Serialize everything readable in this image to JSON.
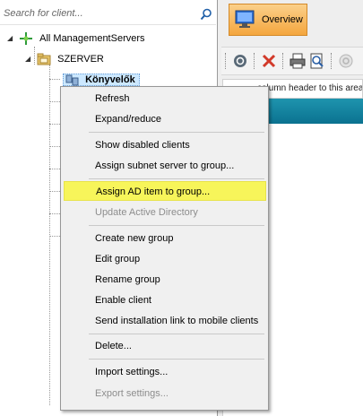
{
  "search": {
    "placeholder": "Search for client..."
  },
  "tree": {
    "root": "All ManagementServers",
    "server": "SZERVER",
    "selected_group": "Könyvelők"
  },
  "overview_tab": {
    "label": "Overview"
  },
  "grid": {
    "group_hint": "column header to this area"
  },
  "context_menu": {
    "refresh": "Refresh",
    "expand_reduce": "Expand/reduce",
    "show_disabled": "Show disabled clients",
    "assign_subnet": "Assign subnet server to group...",
    "assign_ad": "Assign AD item to group...",
    "update_ad": "Update Active Directory",
    "create_group": "Create new group",
    "edit_group": "Edit group",
    "rename_group": "Rename group",
    "enable_client": "Enable client",
    "send_link": "Send installation link to mobile clients",
    "delete": "Delete...",
    "import_settings": "Import settings...",
    "export_settings": "Export settings..."
  },
  "colors": {
    "highlight": "#f7f55a",
    "grid_header": "#0b7290",
    "overview_tab": "#f4a63e",
    "selection": "#cce8ff"
  }
}
